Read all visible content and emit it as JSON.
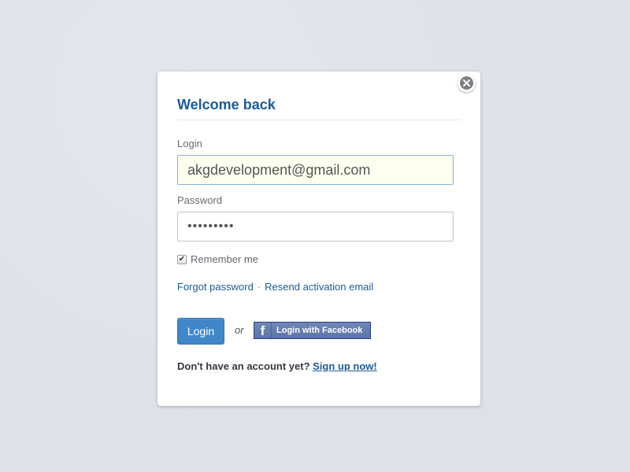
{
  "dialog": {
    "title": "Welcome back",
    "close_icon": "close-icon"
  },
  "login": {
    "label": "Login",
    "value": "akgdevelopment@gmail.com"
  },
  "password": {
    "label": "Password",
    "masked_value": "•••••••••"
  },
  "remember": {
    "label": "Remember me",
    "checked": true
  },
  "links": {
    "forgot": "Forgot password",
    "separator": "·",
    "resend": "Resend activation email"
  },
  "actions": {
    "login_label": "Login",
    "or_text": "or",
    "facebook_label": "Login with Facebook",
    "facebook_icon": "facebook-f-icon"
  },
  "signup": {
    "prompt": "Don't have an account yet?",
    "link": "Sign up now!"
  },
  "colors": {
    "accent": "#1d5a96",
    "button": "#3f87c9",
    "facebook": "#5c74a9",
    "background": "#dde2ea"
  }
}
